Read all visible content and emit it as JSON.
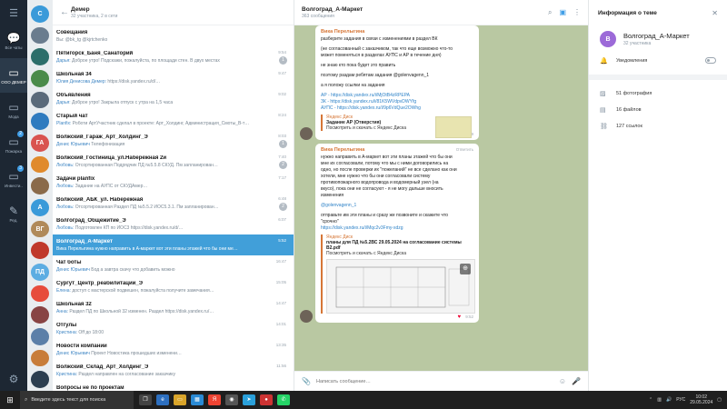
{
  "rail": {
    "items": [
      {
        "label": "Все чаты",
        "icon": "chat-bubble-icon",
        "badge": "",
        "active": false
      },
      {
        "label": "ООО ДЕМЕР",
        "icon": "folder-icon",
        "badge": "",
        "active": true
      },
      {
        "label": "Мода",
        "icon": "folder-icon",
        "badge": "",
        "active": false
      },
      {
        "label": "Пожарка",
        "icon": "folder-icon",
        "badge": "2",
        "active": false
      },
      {
        "label": "Инвести..",
        "icon": "folder-icon",
        "badge": "3",
        "active": false
      },
      {
        "label": "Ред.",
        "icon": "edit-icon",
        "badge": "",
        "active": false
      }
    ]
  },
  "list": {
    "title": "Демер",
    "subtitle": "32 участника, 2 в сети",
    "chats": [
      {
        "name": "Совещания",
        "sender": "",
        "msg": "Вы: @bk_tg @kjrtchenko",
        "time": "",
        "badge": "",
        "avatar": "#3a9ad9",
        "initials": "С"
      },
      {
        "name": "Пятигорск_Баня_Санаторий",
        "sender": "Дарья:",
        "msg": "Доброе утро! Подскажи, пожалуйста, по площади стен. В двух местах",
        "time": "9:54",
        "badge": "1",
        "avatar": "#6a7c8e",
        "initials": ""
      },
      {
        "name": "Школьная 34",
        "sender": "Юлия Денисова Демер:",
        "msg": "https://disk.yandex.ru/d/…",
        "time": "9:47",
        "badge": "",
        "avatar": "#2c6e6a",
        "initials": ""
      },
      {
        "name": "Объявления",
        "sender": "Дарья:",
        "msg": "Доброе утро! Закрыла отпуск с утра на 1,5 часа",
        "time": "9:02",
        "badge": "",
        "avatar": "#4a8b4a",
        "initials": ""
      },
      {
        "name": "Старый чат",
        "sender": "Planfix:",
        "msg": "Роботи АртУчастник сделал в проекте: Арт_Холдинг, Администрация_Смоты_В-т…",
        "time": "8:24",
        "badge": "",
        "avatar": "#5a6a7a",
        "initials": ""
      },
      {
        "name": "Волжский_Гараж_Арт_Холдинг_Э",
        "sender": "Денис Юрьевич",
        "msg": "Телефонизация",
        "time": "8:03",
        "badge": "1",
        "avatar": "#2f7bbf",
        "initials": ""
      },
      {
        "name": "Волжский_Гостиница_ул.Набережная 2и",
        "sender": "Любовь:",
        "msg": "Отсортированная Подрядчик ПД №5.5.8 СКУД. Пм запланирован…",
        "time": "7:40",
        "badge": "2",
        "avatar": "#d9534f",
        "initials": "ГА"
      },
      {
        "name": "Задачи planfix",
        "sender": "Любовь:",
        "msg": "Задание на АУПС от СКУДАмер…",
        "time": "7:17",
        "badge": "",
        "avatar": "#e08a2c",
        "initials": ""
      },
      {
        "name": "Волжский_АБК_ул. Набережная",
        "sender": "Любовь:",
        "msg": "Отсортированная Раздел ПД №5.5.2 ИОС5.3.1. Пм запланирован…",
        "time": "6:48",
        "badge": "2",
        "avatar": "#8a6a4a",
        "initials": ""
      },
      {
        "name": "Волгоград_Общежитие_Э",
        "sender": "Любовь:",
        "msg": "Подготовлен КП по ИОС3 https://disk.yandex.ru/d/…",
        "time": "6:07",
        "badge": "",
        "avatar": "#3a9ad9",
        "initials": "А"
      },
      {
        "name": "Волгоград_А-Маркет",
        "sender": "Вика Перелыгина",
        "msg": "нужно направить в А-маркет вот эти планы этажей что бы они ме…",
        "time": "5:52",
        "badge": "",
        "avatar": "#b08a5a",
        "initials": "ВГ"
      },
      {
        "name": "Чат боты",
        "sender": "Денис Юрьевич",
        "msg": "Бод а завтра скачу что добавить можно",
        "time": "16:47",
        "badge": "",
        "avatar": "#c0392b",
        "initials": ""
      },
      {
        "name": "Сургут_Центр_реабилитации_Э",
        "sender": "Елена:",
        "msg": "доступ с мастерской подвешен, пожалуйста получите замечания…",
        "time": "15:05",
        "badge": "",
        "avatar": "#5dade2",
        "initials": "ПД"
      },
      {
        "name": "Школьная 32",
        "sender": "Анна:",
        "msg": "Раздел ПД по Школьной 32 изменен. Раздел https://disk.yandex.ru/…",
        "time": "14:47",
        "badge": "",
        "avatar": "#e74c3c",
        "initials": ""
      },
      {
        "name": "Отгулы",
        "sender": "Кристина:",
        "msg": "Off до 18:00",
        "time": "14:01",
        "badge": "",
        "avatar": "#884444",
        "initials": ""
      },
      {
        "name": "Новости компании",
        "sender": "Денис Юрьевич",
        "msg": "Проект Новостика прошедших изменени…",
        "time": "13:35",
        "badge": "",
        "avatar": "#5b7fa8",
        "initials": ""
      },
      {
        "name": "Волжский_Склад_Арт_Холдинг_Э",
        "sender": "Кристина:",
        "msg": "Раздел направлен на согласование заказчику",
        "time": "11:56",
        "badge": "",
        "avatar": "#c87d3a",
        "initials": ""
      },
      {
        "name": "Вопросы не по проектам",
        "sender": "Иван:",
        "msg": "https://disk.yandex.ru/…",
        "time": "",
        "badge": "",
        "avatar": "#2c3e50",
        "initials": ""
      }
    ]
  },
  "chat": {
    "title": "Волгоград_А-Маркет",
    "subtitle": "363 сообщения",
    "input_placeholder": "Написать сообщение…",
    "msg1": {
      "sender": "Вика Перелыгина",
      "lines": [
        "разберите задания в связи с изменениями в раздел ВК",
        "",
        "(не согласованный с заказчиком, так что еще возможно что-то",
        "может поменяться в разделах АУПС и АР в течение дня)",
        "",
        "не знаю кто пока будет это править",
        "",
        "поэтому раздам ребятам задания @golenvagenn_1",
        "",
        "а я положу ссылки на задания"
      ],
      "links": [
        "АР - https://disk.yandex.ru/i/MjOtB4zRPEPA",
        "ЗК - https://disk.yandex.ru/i/81K5WVdpvDWYfg",
        "АУПС - https://disk.yandex.ru/i/9p6VdQue2OWhg"
      ],
      "preview_src": "Яндекс Диск",
      "preview_title": "Задание АР (Отверстия)",
      "preview_desc": "Посмотреть и скачать с Яндекс Диска",
      "time": "9:29"
    },
    "msg2": {
      "sender": "Вика Перелыгина",
      "reply": "Ответить",
      "lines": [
        "нужно направить в А-маркет вот эти планы этажей что бы они",
        "мне их согласовали, потому что мы с ними договорились на",
        "одно, но после проверки их \"пожеланий\" не все сделано как они",
        "хотели, мне нужно что бы они согласовали систему",
        "противопожарного водопровода и водомерный узел (на",
        "вкусо), пока они не согласуют - я не могу дальше вносить",
        "изменения"
      ],
      "mention": "@golenvagenn_1",
      "lines2": [
        "отправьте им эти планы и сразу же позвоните и скажите что",
        "\"срочно\""
      ],
      "link": "https://disk.yandex.ru/i/Mqc2v3Fmy-xdzg",
      "preview_src": "Яндекс Диск",
      "preview_title": "планы для ПД №5.2ВС 29.05.2024 на согласование системы В2.pdf",
      "preview_desc": "Посмотреть и скачать с Яндекс Диска",
      "reaction": "♥",
      "time": "9:52"
    }
  },
  "info": {
    "header": "Информация о теме",
    "name": "Волгоград_А-Маркет",
    "count": "32 участника",
    "initials": "В",
    "notifications": "Уведомления",
    "photos": "51 фотография",
    "files": "16 файлов",
    "links": "127 ссылок"
  },
  "taskbar": {
    "search": "Введите здесь текст для поиска",
    "lang": "РУС",
    "time": "10:02",
    "date": "29.05.2024"
  }
}
